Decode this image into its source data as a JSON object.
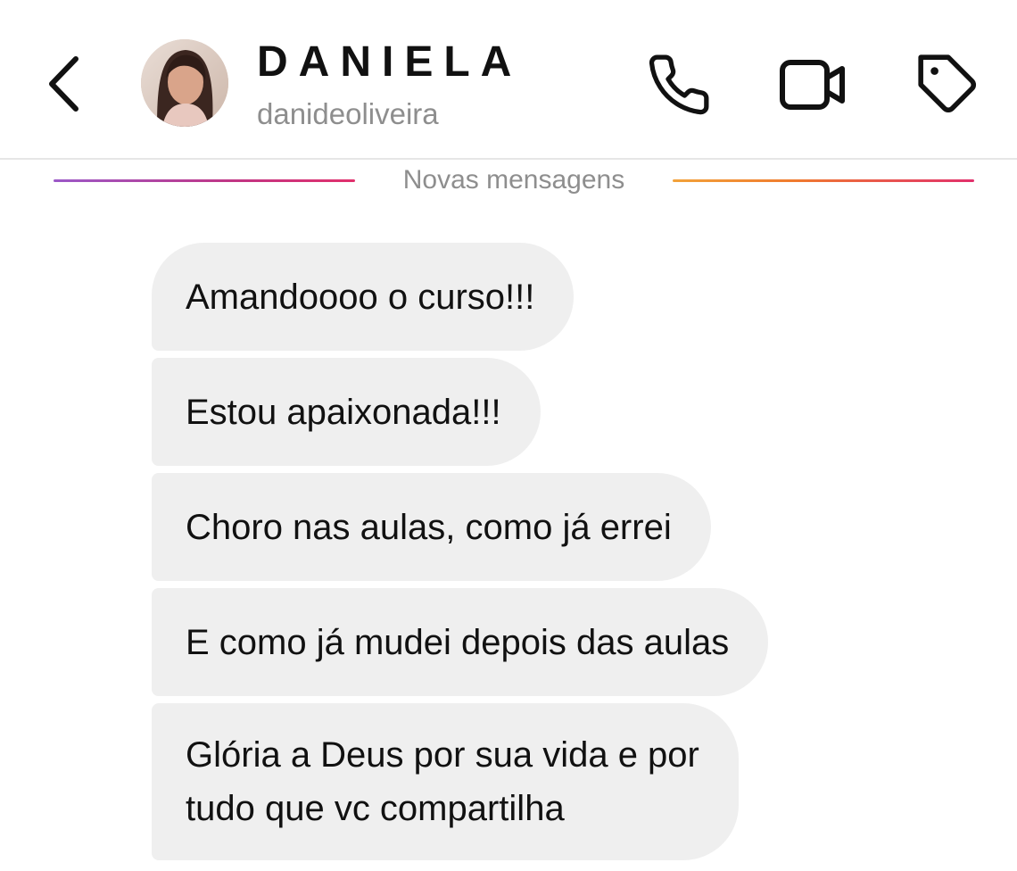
{
  "header": {
    "contact_name": "DANIELA",
    "username": "danideoliveira",
    "icons": [
      "back-icon",
      "phone-icon",
      "video-camera-icon",
      "tag-icon"
    ]
  },
  "separator": {
    "label": "Novas mensagens",
    "colors": {
      "left_gradient": [
        "#9b59c8",
        "#c13584",
        "#e1306c"
      ],
      "right_gradient": [
        "#f2a23a",
        "#f07b2e",
        "#e1306c"
      ]
    }
  },
  "messages": [
    {
      "text": "Amandoooo o curso!!!"
    },
    {
      "text": "Estou apaixonada!!!"
    },
    {
      "text": "Choro nas aulas, como já errei"
    },
    {
      "text": "E como já mudei depois das aulas"
    },
    {
      "text_line1": "Glória a Deus por sua vida e por",
      "text_line2": "tudo que vc compartilha"
    }
  ],
  "colors": {
    "bubble_bg": "#efefef",
    "secondary_text": "#8e8e8e",
    "divider": "#e6e6e6"
  }
}
